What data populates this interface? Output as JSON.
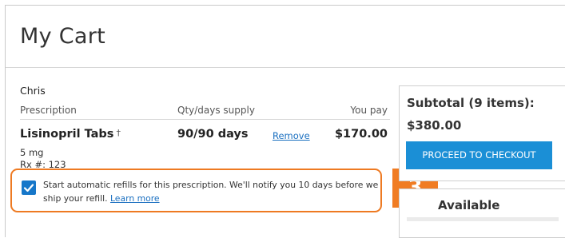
{
  "page": {
    "title": "My Cart"
  },
  "cart": {
    "patient_name": "Chris",
    "columns": {
      "prescription": "Prescription",
      "qty": "Qty/days supply",
      "pay": "You pay"
    },
    "item": {
      "drug_name": "Lisinopril Tabs",
      "dagger": "†",
      "qty": "90/90 days",
      "remove_label": "Remove",
      "price": "$170.00",
      "strength": "5 mg",
      "rx_number": "Rx #: 123"
    },
    "refill": {
      "checked": true,
      "text": "Start automatic refills for this prescription. We'll notify you 10 days before we ship your refill.",
      "link_label": "Learn more"
    }
  },
  "summary": {
    "subtotal_label": "Subtotal (9 items):",
    "subtotal_value": "$380.00",
    "checkout_label": "PROCEED TO CHECKOUT",
    "available_label": "Available"
  },
  "callout": {
    "number": "3"
  },
  "colors": {
    "accent": "#1b8fd6",
    "callout": "#f07c23",
    "link": "#1a6fc0"
  }
}
